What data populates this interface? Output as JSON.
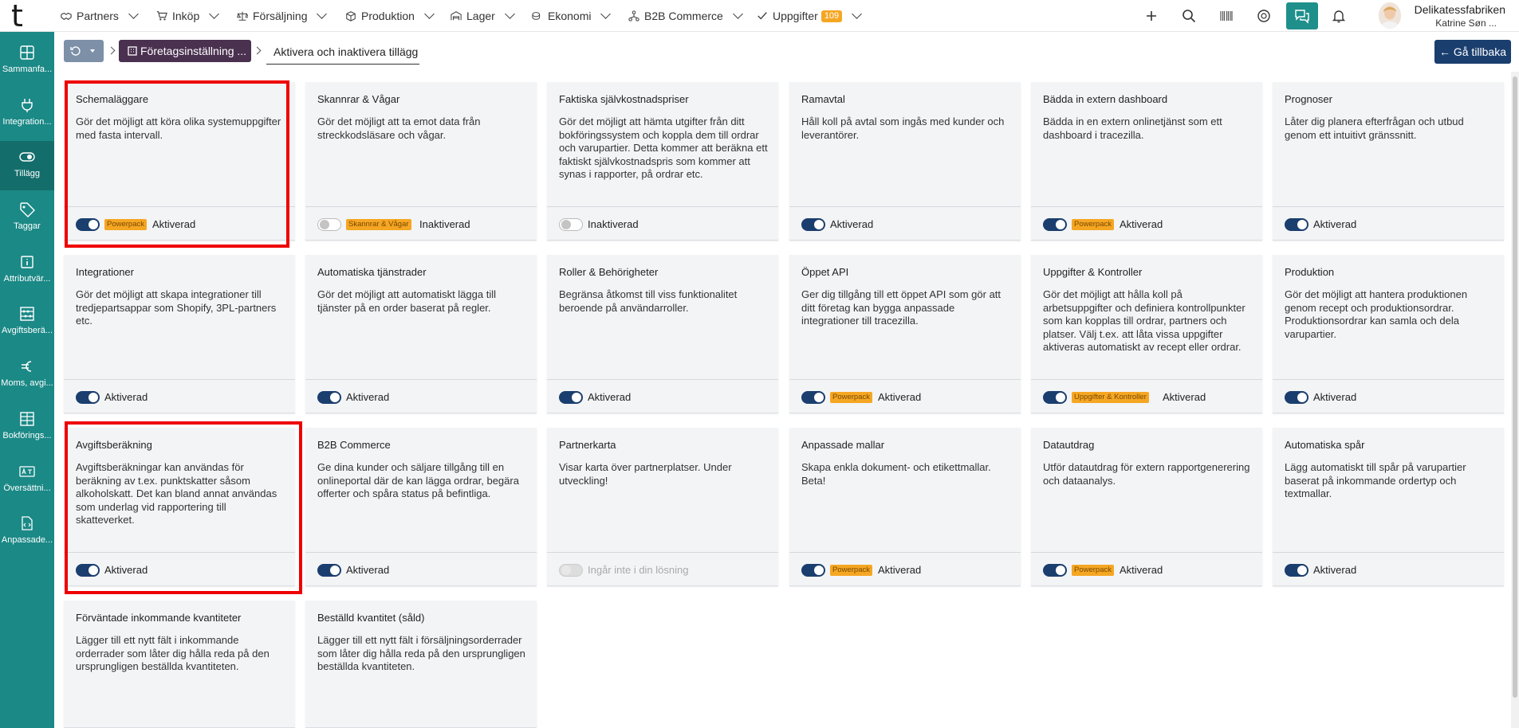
{
  "app": {
    "logo": "t"
  },
  "nav": [
    {
      "label": "Partners",
      "icon": "handshake-icon"
    },
    {
      "label": "Inköp",
      "icon": "cart-icon"
    },
    {
      "label": "Försäljning",
      "icon": "scale-icon"
    },
    {
      "label": "Produktion",
      "icon": "box-icon"
    },
    {
      "label": "Lager",
      "icon": "warehouse-icon"
    },
    {
      "label": "Ekonomi",
      "icon": "coins-icon"
    },
    {
      "label": "B2B Commerce",
      "icon": "network-icon"
    },
    {
      "label": "Uppgifter",
      "icon": "check-icon",
      "badge": "109"
    }
  ],
  "user": {
    "company": "Delikatessfabriken",
    "name": "Katrine Søn ..."
  },
  "sidebar": [
    {
      "label": "Sammanfa..."
    },
    {
      "label": "Integration..."
    },
    {
      "label": "Tillägg"
    },
    {
      "label": "Taggar"
    },
    {
      "label": "Attributvär..."
    },
    {
      "label": "Avgiftsberä..."
    },
    {
      "label": "Moms, avgi..."
    },
    {
      "label": "Bokförings..."
    },
    {
      "label": "Översättni..."
    },
    {
      "label": "Anpassade..."
    }
  ],
  "breadcrumb": {
    "crumb1": "Företagsinställning ...",
    "crumb2": "Aktivera och inaktivera tillägg",
    "back": "← Gå tillbaka"
  },
  "colors": {
    "accent": "#1b8986",
    "navy": "#1a3e6e",
    "tag": "#f5a623",
    "highlight": "#ee0000"
  },
  "cards": [
    {
      "title": "Schemaläggare",
      "desc": "Gör det möjligt att köra olika systemuppgifter med fasta intervall.",
      "toggle": "on",
      "tag": "Powerpack",
      "status": "Aktiverad"
    },
    {
      "title": "Skannrar & Vågar",
      "desc": "Gör det möjligt att ta emot data från streckkodsläsare och vågar.",
      "toggle": "off",
      "tag": "Skannrar & Vågar",
      "status": "Inaktiverad"
    },
    {
      "title": "Faktiska självkostnadspriser",
      "desc": "Gör det möjligt att hämta utgifter från ditt bokföringssystem och koppla dem till ordrar och varupartier. Detta kommer att beräkna ett faktiskt självkostnadspris som kommer att synas i rapporter, på ordrar etc.",
      "toggle": "off",
      "tag": "",
      "status": "Inaktiverad"
    },
    {
      "title": "Ramavtal",
      "desc": "Håll koll på avtal som ingås med kunder och leverantörer.",
      "toggle": "on",
      "tag": "",
      "status": "Aktiverad"
    },
    {
      "title": "Bädda in extern dashboard",
      "desc": "Bädda in en extern onlinetjänst som ett dashboard i tracezilla.",
      "toggle": "on",
      "tag": "Powerpack",
      "status": "Aktiverad"
    },
    {
      "title": "Prognoser",
      "desc": "Låter dig planera efterfrågan och utbud genom ett intuitivt gränssnitt.",
      "toggle": "on",
      "tag": "",
      "status": "Aktiverad"
    },
    {
      "title": "Integrationer",
      "desc": "Gör det möjligt att skapa integrationer till tredjepartsappar som Shopify, 3PL-partners etc.",
      "toggle": "on",
      "tag": "",
      "status": "Aktiverad"
    },
    {
      "title": "Automatiska tjänstrader",
      "desc": "Gör det möjligt att automatiskt lägga till tjänster på en order baserat på regler.",
      "toggle": "on",
      "tag": "",
      "status": "Aktiverad"
    },
    {
      "title": "Roller & Behörigheter",
      "desc": "Begränsa åtkomst till viss funktionalitet beroende på användarroller.",
      "toggle": "on",
      "tag": "",
      "status": "Aktiverad"
    },
    {
      "title": "Öppet API",
      "desc": "Ger dig tillgång till ett öppet API som gör att ditt företag kan bygga anpassade integrationer till tracezilla.",
      "toggle": "on",
      "tag": "Powerpack",
      "status": "Aktiverad"
    },
    {
      "title": "Uppgifter & Kontroller",
      "desc": "Gör det möjligt att hålla koll på arbetsuppgifter och definiera kontrollpunkter som kan kopplas till ordrar, partners och platser. Välj t.ex. att låta vissa uppgifter aktiveras automatiskt av recept eller ordrar.",
      "toggle": "on",
      "tag": "Uppgifter & Kontroller",
      "status": "Aktiverad"
    },
    {
      "title": "Produktion",
      "desc": "Gör det möjligt att hantera produktionen genom recept och produktionsordrar. Produktionsordrar kan samla och dela varupartier.",
      "toggle": "on",
      "tag": "",
      "status": "Aktiverad"
    },
    {
      "title": "Avgiftsberäkning",
      "desc": "Avgiftsberäkningar kan användas för beräkning av t.ex. punktskatter såsom alkoholskatt. Det kan bland annat användas som underlag vid rapportering till skatteverket.",
      "toggle": "on",
      "tag": "",
      "status": "Aktiverad"
    },
    {
      "title": "B2B Commerce",
      "desc": "Ge dina kunder och säljare tillgång till en onlineportal där de kan lägga ordrar, begära offerter och spåra status på befintliga.",
      "toggle": "on",
      "tag": "",
      "status": "Aktiverad"
    },
    {
      "title": "Partnerkarta",
      "desc": "Visar karta över partnerplatser. Under utveckling!",
      "toggle": "disabled",
      "tag": "",
      "status": "Ingår inte i din lösning"
    },
    {
      "title": "Anpassade mallar",
      "desc": "Skapa enkla dokument- och etikettmallar. Beta!",
      "toggle": "on",
      "tag": "Powerpack",
      "status": "Aktiverad"
    },
    {
      "title": "Datautdrag",
      "desc": "Utför datautdrag för extern rapportgenerering och dataanalys.",
      "toggle": "on",
      "tag": "Powerpack",
      "status": "Aktiverad"
    },
    {
      "title": "Automatiska spår",
      "desc": "Lägg automatiskt till spår på varupartier baserat på inkommande ordertyp och textmallar.",
      "toggle": "on",
      "tag": "",
      "status": "Aktiverad"
    },
    {
      "title": "Förväntade inkommande kvantiteter",
      "desc": "Lägger till ett nytt fält i inkommande orderrader som låter dig hålla reda på den ursprungligen beställda kvantiteten.",
      "toggle": "",
      "tag": "",
      "status": ""
    },
    {
      "title": "Beställd kvantitet (såld)",
      "desc": "Lägger till ett nytt fält i försäljningsorderrader som låter dig hålla reda på den ursprungligen beställda kvantiteten.",
      "toggle": "",
      "tag": "",
      "status": ""
    }
  ]
}
